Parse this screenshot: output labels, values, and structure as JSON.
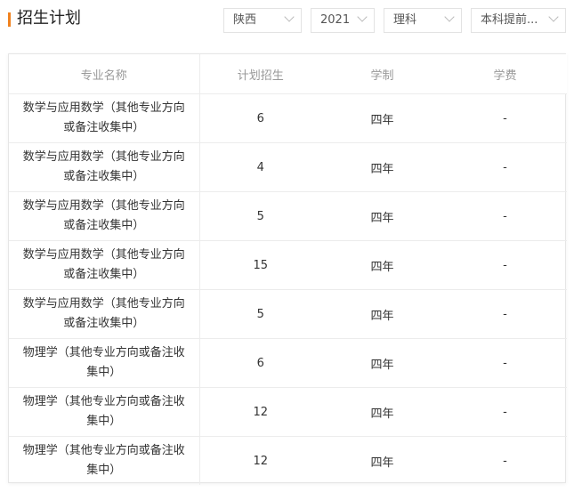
{
  "header": {
    "title": "招生计划"
  },
  "filters": [
    {
      "value": "陕西"
    },
    {
      "value": "2021"
    },
    {
      "value": "理科"
    },
    {
      "value": "本科提前..."
    }
  ],
  "table": {
    "columns": [
      "专业名称",
      "计划招生",
      "学制",
      "学费"
    ],
    "rows": [
      [
        "数学与应用数学（其他专业方向或备注收集中）",
        "6",
        "四年",
        "-"
      ],
      [
        "数学与应用数学（其他专业方向或备注收集中）",
        "4",
        "四年",
        "-"
      ],
      [
        "数学与应用数学（其他专业方向或备注收集中）",
        "5",
        "四年",
        "-"
      ],
      [
        "数学与应用数学（其他专业方向或备注收集中）",
        "15",
        "四年",
        "-"
      ],
      [
        "数学与应用数学（其他专业方向或备注收集中）",
        "5",
        "四年",
        "-"
      ],
      [
        "物理学（其他专业方向或备注收集中）",
        "6",
        "四年",
        "-"
      ],
      [
        "物理学（其他专业方向或备注收集中）",
        "12",
        "四年",
        "-"
      ],
      [
        "物理学（其他专业方向或备注收集中）",
        "12",
        "四年",
        "-"
      ]
    ]
  },
  "colors": {
    "accent": "#f0821e"
  }
}
